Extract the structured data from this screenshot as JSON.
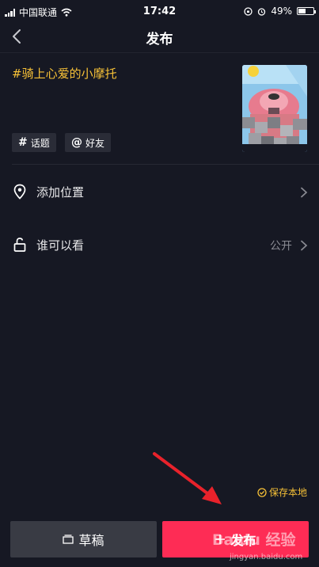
{
  "status_bar": {
    "carrier": "中国联通",
    "time": "17:42",
    "battery_percent": "49%",
    "battery_level": 0.49
  },
  "header": {
    "title": "发布"
  },
  "post": {
    "caption": "#骑上心爱的小摩托"
  },
  "tags": {
    "topic_symbol": "#",
    "topic_label": "话题",
    "friend_symbol": "@",
    "friend_label": "好友"
  },
  "settings": {
    "location_label": "添加位置",
    "visibility_label": "谁可以看",
    "visibility_value": "公开"
  },
  "footer": {
    "save_local_label": "保存本地",
    "draft_label": "草稿",
    "publish_label": "发布"
  },
  "watermark": {
    "text": "Baidu 经验",
    "url": "jingyan.baidu.com"
  },
  "colors": {
    "background": "#161823",
    "accent_yellow": "#f7c137",
    "publish_red": "#fe2c55",
    "draft_gray": "#393b44"
  }
}
